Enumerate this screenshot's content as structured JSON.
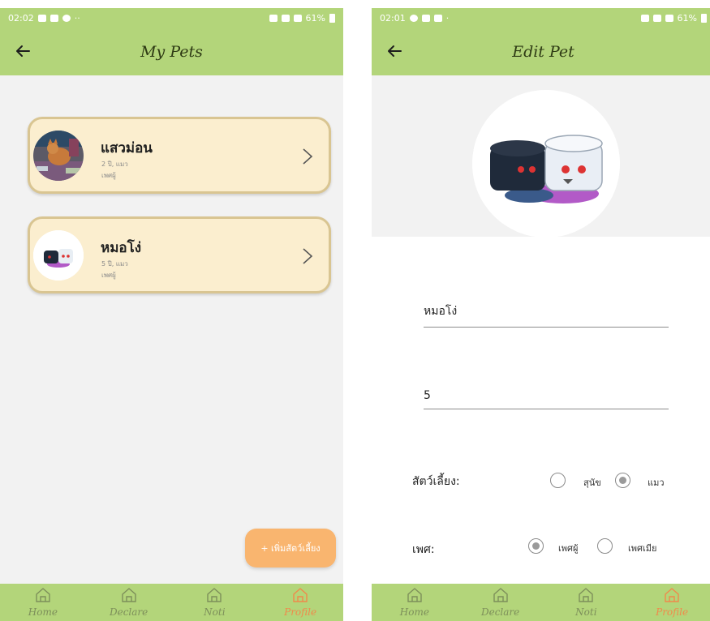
{
  "left_screen": {
    "status": {
      "time": "02:02",
      "extra": "··",
      "right": "61%"
    },
    "title": "My Pets",
    "pets": [
      {
        "name": "แสวม่อน",
        "info": "2 ปี, แมว",
        "gender": "เพศผู้"
      },
      {
        "name": "หมอโง่",
        "info": "5 ปี, แมว",
        "gender": "เพศผู้"
      }
    ],
    "add_button": "+ เพิ่มสัตว์เลี้ยง"
  },
  "right_screen": {
    "status": {
      "time": "02:01",
      "extra": "·",
      "right": "61%"
    },
    "title": "Edit Pet",
    "name_value": "หมอโง่",
    "age_value": "5",
    "animal_label": "สัตว์เลี้ยง:",
    "animal_options": [
      "สุนัข",
      "แมว"
    ],
    "animal_selected": "แมว",
    "gender_label": "เพศ:",
    "gender_options": [
      "เพศผู้",
      "เพศเมีย"
    ],
    "gender_selected": "เพศผู้"
  },
  "bottom_nav": {
    "items": [
      {
        "label": "Home",
        "icon": "home-icon"
      },
      {
        "label": "Declare",
        "icon": "home-icon"
      },
      {
        "label": "Noti",
        "icon": "home-icon"
      },
      {
        "label": "Profile",
        "icon": "home-icon"
      }
    ],
    "active": "Profile"
  },
  "colors": {
    "appbar": "#b3d57a",
    "card_fill": "#fbeecf",
    "card_border": "#d9c592",
    "fab": "#f9b56f",
    "active_nav": "#f08a4b"
  }
}
